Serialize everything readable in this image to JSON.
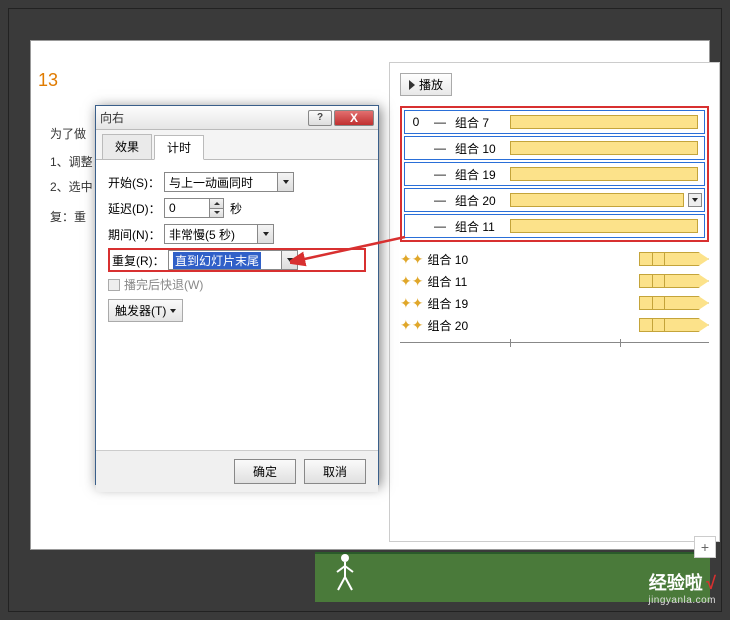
{
  "slide_number": "13",
  "background_text": {
    "line1": "为了做",
    "line2": "1、调整",
    "line3": "2、选中",
    "line4": "复：重"
  },
  "dialog": {
    "title": "向右",
    "tabs": {
      "effect": "效果",
      "timing": "计时"
    },
    "labels": {
      "start": "开始(S)：",
      "delay": "延迟(D)：",
      "duration": "期间(N)：",
      "repeat": "重复(R)：",
      "rewind": "播完后快退(W)",
      "trigger": "触发器(T)",
      "seconds": "秒"
    },
    "values": {
      "start": "与上一动画同时",
      "delay": "0",
      "duration": "非常慢(5 秒)",
      "repeat": "直到幻灯片末尾"
    },
    "buttons": {
      "ok": "确定",
      "cancel": "取消"
    }
  },
  "anim_pane": {
    "play": "播放",
    "items": [
      {
        "idx": "0",
        "label": "组合 7"
      },
      {
        "idx": "",
        "label": "组合 10"
      },
      {
        "idx": "",
        "label": "组合 19"
      },
      {
        "idx": "",
        "label": "组合 20"
      },
      {
        "idx": "",
        "label": "组合 11"
      }
    ],
    "below": [
      {
        "label": "组合 10"
      },
      {
        "label": "组合 11"
      },
      {
        "label": "组合 19"
      },
      {
        "label": "组合 20"
      }
    ]
  },
  "watermark": {
    "cn": "经验啦",
    "en": "jingyanla.com"
  },
  "icons": {
    "plus": "+",
    "close": "X",
    "help": "?"
  }
}
